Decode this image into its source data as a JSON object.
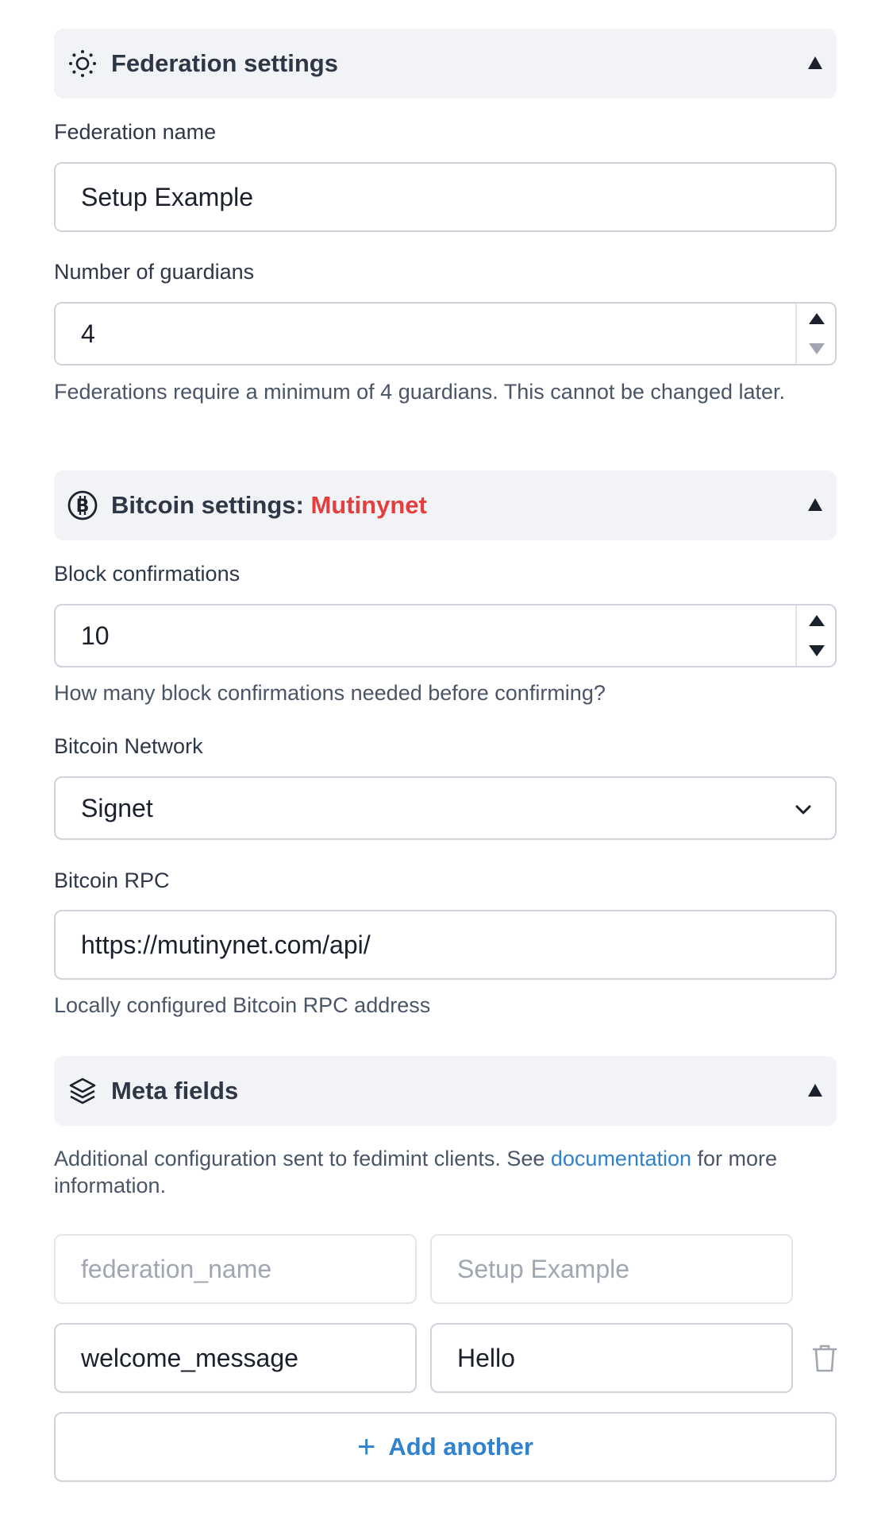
{
  "federation": {
    "title": "Federation settings",
    "name_label": "Federation name",
    "name_value": "Setup Example",
    "guardians_label": "Number of guardians",
    "guardians_value": "4",
    "guardians_helper": "Federations require a minimum of 4 guardians. This cannot be changed later."
  },
  "bitcoin": {
    "title_prefix": "Bitcoin settings:",
    "title_accent": "Mutinynet",
    "confirmations_label": "Block confirmations",
    "confirmations_value": "10",
    "confirmations_helper": "How many block confirmations needed before confirming?",
    "network_label": "Bitcoin Network",
    "network_value": "Signet",
    "rpc_label": "Bitcoin RPC",
    "rpc_value": "https://mutinynet.com/api/",
    "rpc_helper": "Locally configured Bitcoin RPC address"
  },
  "meta": {
    "title": "Meta fields",
    "helper_before": "Additional configuration sent to fedimint clients. See",
    "helper_link": "documentation",
    "helper_after": "for more information.",
    "rows": [
      {
        "key": "federation_name",
        "value": "Setup Example"
      },
      {
        "key": "welcome_message",
        "value": "Hello"
      }
    ],
    "add_label": "Add another"
  },
  "colors": {
    "accent_red": "#e53e3e",
    "link_blue": "#3182ce",
    "header_bg": "#f2f3f6"
  },
  "icons": [
    "sun-icon",
    "bitcoin-icon",
    "layers-icon",
    "caret-up-icon",
    "chevron-down-icon",
    "trash-icon",
    "plus-icon"
  ]
}
